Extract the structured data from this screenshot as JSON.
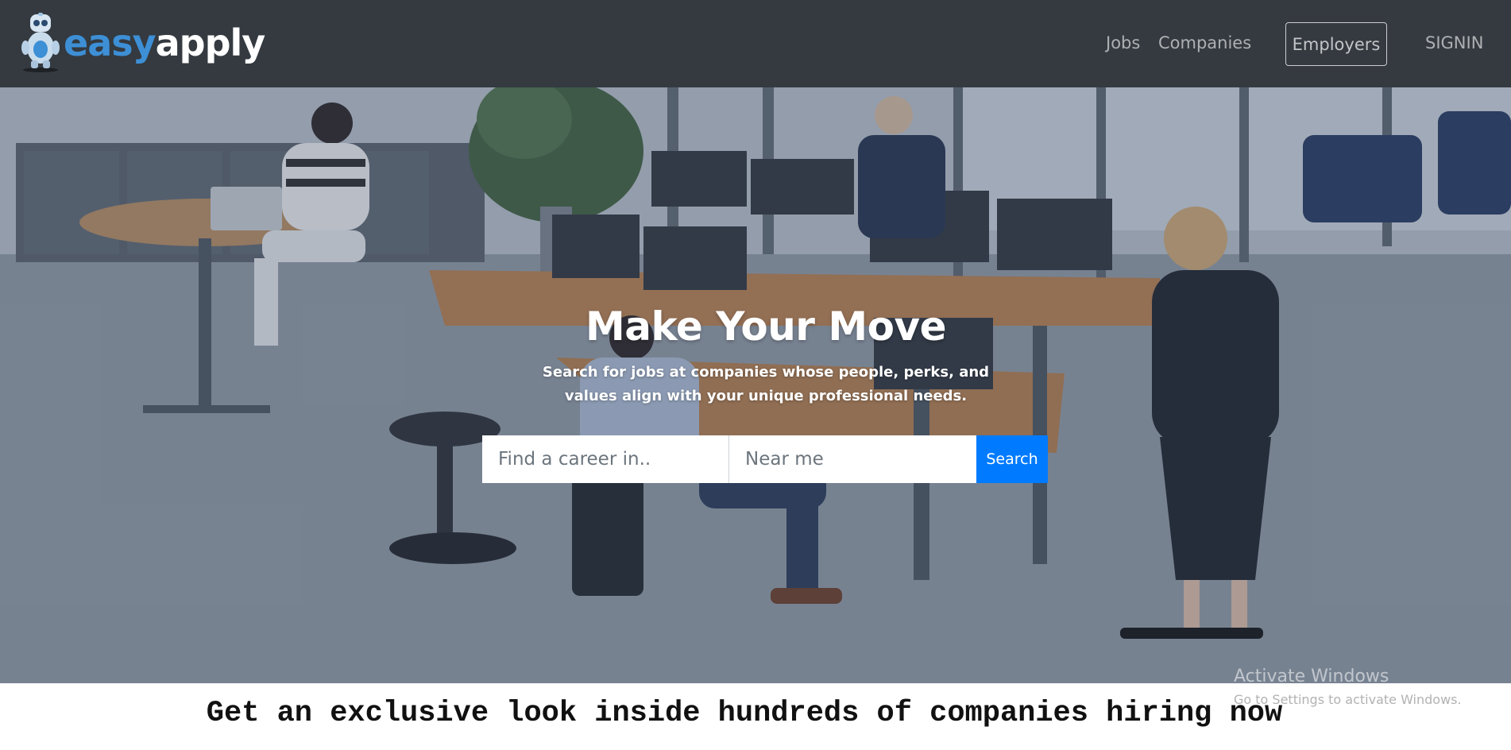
{
  "brand": {
    "part1": "easy",
    "part2": "apply"
  },
  "nav": {
    "jobs": "Jobs",
    "companies": "Companies",
    "employers": "Employers",
    "signin": "SIGNIN"
  },
  "hero": {
    "title": "Make Your Move",
    "subtitle": "Search for jobs at companies whose people, perks, and values align with your unique professional needs.",
    "search": {
      "career_placeholder": "Find a career in..",
      "location_placeholder": "Near me",
      "button_label": "Search"
    }
  },
  "banner": {
    "text": "Get an exclusive look inside hundreds of companies hiring now"
  },
  "watermark": {
    "title": "Activate Windows",
    "subtitle": "Go to Settings to activate Windows."
  },
  "colors": {
    "navbar": "#343a40",
    "brand_blue": "#3d8fd6",
    "search_button": "#007bff"
  }
}
